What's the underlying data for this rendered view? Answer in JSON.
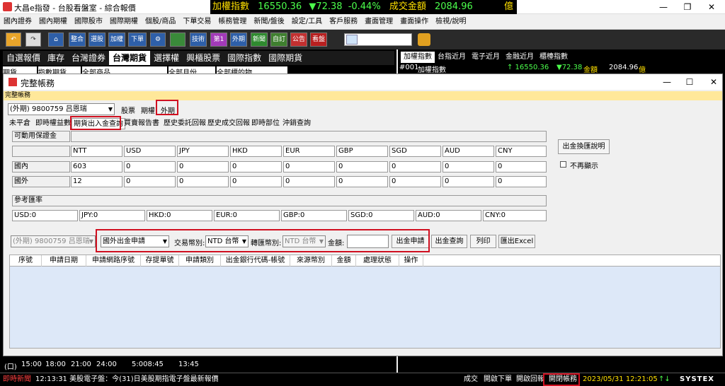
{
  "window": {
    "title": "大昌e指發 - 台股看盤室 - 綜合報價",
    "ticker_name": "加權指數",
    "ticker_value": "16550.36",
    "ticker_change": "▼72.38",
    "ticker_pct": "-0.44%",
    "ticker_amt_label": "成交金額",
    "ticker_amt": "2084.96",
    "ticker_unit": "億",
    "min": "—",
    "max": "❐",
    "close": "✕"
  },
  "menu": [
    "國內證券",
    "國內期權",
    "國際股市",
    "國際期權",
    "個股/商品",
    "下單交易",
    "帳務管理",
    "新聞/盤後",
    "設定/工具",
    "客戶服務",
    "畫面管理",
    "畫面操作",
    "檢視/說明"
  ],
  "toolbar": {
    "undo": "↶",
    "redo": "↷",
    "home": "⌂",
    "b1": "整合",
    "b2": "選股",
    "b3": "加權",
    "b4": "下單",
    "b5": "⚙",
    "b6": "技術",
    "b7": "第1",
    "b8": "外期",
    "b9": "新聞",
    "b10": "自訂",
    "b11": "公告",
    "b12": "看盤"
  },
  "left_tabs": [
    "自選報價",
    "庫存",
    "台灣證券",
    "台灣期貨",
    "選擇權",
    "興櫃股票",
    "國際指數",
    "國際期貨"
  ],
  "left_filters": [
    "期貨",
    "指數期貨",
    "全部商品",
    "全部月份",
    "全部標的物"
  ],
  "right_tabs": [
    "加權指數",
    "台指近月",
    "電子近月",
    "金融近月",
    "櫃檯指數"
  ],
  "right_row": {
    "code": "#001",
    "name": "加權指數",
    "price": "↑ 16550.36",
    "change": "▼72.38",
    "amt_label": "金額",
    "amt": "2084.96",
    "unit": "億"
  },
  "dialog": {
    "title": "完整帳務",
    "min": "—",
    "max": "☐",
    "close": "✕",
    "header": "完整帳務",
    "account": "(外期) 9800759 吕恩瑞",
    "type_tabs": [
      "股票",
      "期權",
      "外期"
    ],
    "sub_tabs": [
      "未平倉",
      "即時權益數",
      "期貨出入金查詢",
      "買賣報告書",
      "歷史委託回報",
      "歷史成交回報",
      "即時部位",
      "沖銷查詢"
    ],
    "margin_label": "可動用保證金",
    "currencies": [
      "NTT",
      "USD",
      "JPY",
      "HKD",
      "EUR",
      "GBP",
      "SGD",
      "AUD",
      "CNY"
    ],
    "rows": [
      {
        "label": "國內",
        "values": [
          "603",
          "0",
          "0",
          "0",
          "0",
          "0",
          "0",
          "0",
          "0"
        ]
      },
      {
        "label": "國外",
        "values": [
          "12",
          "0",
          "0",
          "0",
          "0",
          "0",
          "0",
          "0",
          "0"
        ]
      }
    ],
    "rate_label": "參考匯率",
    "rates": [
      "USD:0",
      "JPY:0",
      "HKD:0",
      "EUR:0",
      "GBP:0",
      "SGD:0",
      "AUD:0",
      "CNY:0"
    ],
    "explain_btn": "出金換匯說明",
    "no_show": "不再顯示",
    "req_account": "(外期) 9800759 吕恩瑞",
    "req_type": "國外出金申請",
    "trade_ccy_label": "交易幣別:",
    "trade_ccy": "NTD 台幣",
    "conv_ccy_label": "轉匯幣別:",
    "conv_ccy": "NTD 台幣",
    "amount_label": "金額:",
    "amount": "",
    "apply_btn": "出金申請",
    "query_btn": "出金查詢",
    "print_btn": "列印",
    "excel_btn": "匯出Excel",
    "grid_cols": [
      "序號",
      "申請日期",
      "申請網路序號",
      "存提單號",
      "申請類別",
      "出金銀行代碼-帳號",
      "來源幣別",
      "金額",
      "處理狀態",
      "操作"
    ]
  },
  "bottom_times": [
    "(口)",
    "15:00",
    "18:00",
    "21:00",
    "24:00",
    "5:008:45",
    "13:45"
  ],
  "status": {
    "news_label": "即時新聞",
    "news": "12:13:31 美股電子盤：今(31)日美股期指電子盤最新報價",
    "s1": "成交",
    "s2": "開啟下單",
    "s3": "開啟回報",
    "s4": "開閉帳務",
    "datetime": "2023/05/31 12:21:05",
    "brand": "SYSTEX"
  }
}
